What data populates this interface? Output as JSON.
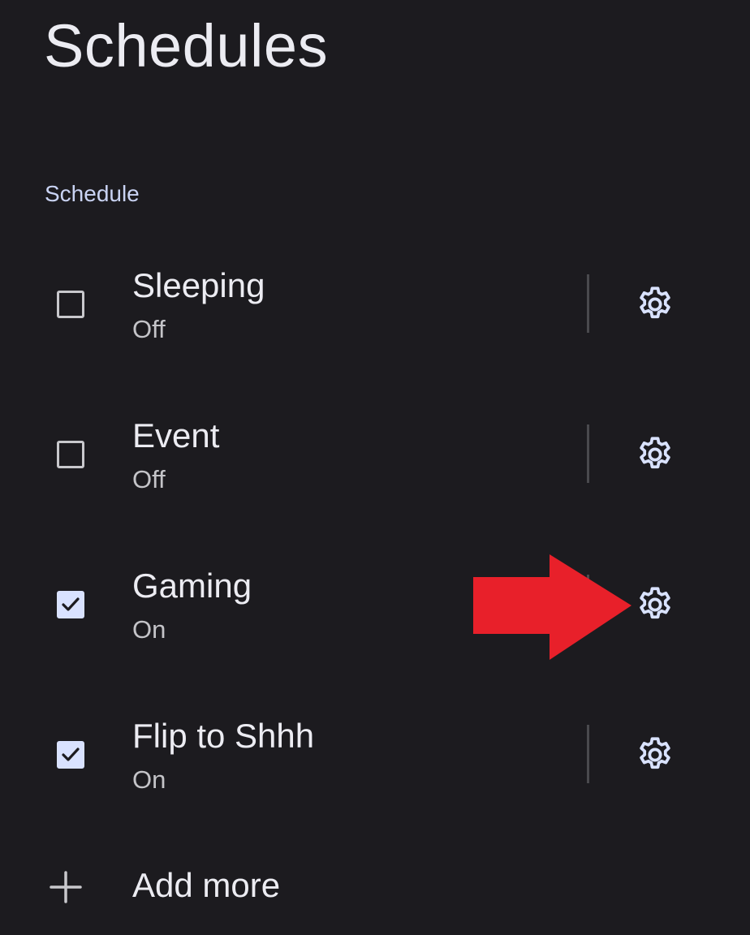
{
  "page": {
    "title": "Schedules",
    "section_header": "Schedule"
  },
  "schedules": [
    {
      "label": "Sleeping",
      "status": "Off",
      "checked": false
    },
    {
      "label": "Event",
      "status": "Off",
      "checked": false
    },
    {
      "label": "Gaming",
      "status": "On",
      "checked": true
    },
    {
      "label": "Flip to Shhh",
      "status": "On",
      "checked": true
    }
  ],
  "add_more": {
    "label": "Add more"
  },
  "icons": {
    "settings": "gear-icon",
    "add": "plus-icon",
    "checkmark": "checkmark-icon",
    "annotation": "red-arrow-icon"
  },
  "colors": {
    "background": "#1c1b1f",
    "text_primary": "#ececf2",
    "text_secondary": "#c4c4c8",
    "accent": "#d9e2ff",
    "section_header": "#c9d3f3",
    "arrow": "#e8202a"
  }
}
